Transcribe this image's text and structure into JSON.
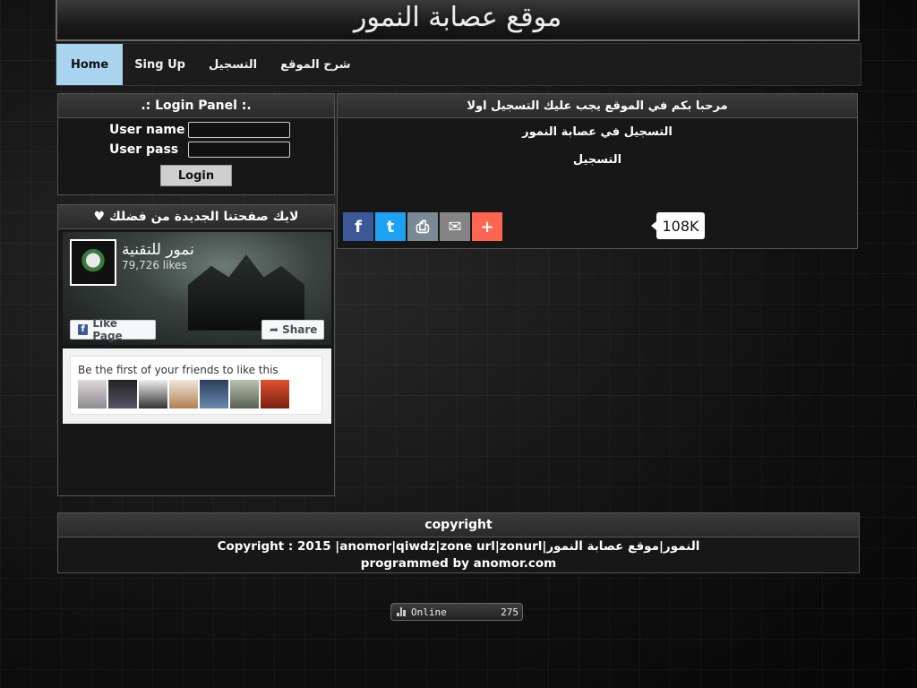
{
  "header": {
    "title": "موقع عصابة النمور"
  },
  "nav": [
    {
      "label": "Home",
      "active": true
    },
    {
      "label": "Sing Up"
    },
    {
      "label": "التسجيل"
    },
    {
      "label": "شرح الموقع"
    }
  ],
  "login": {
    "title": ".: Login Panel :.",
    "username_label": "User name",
    "password_label": "User pass",
    "username_value": "",
    "password_value": "",
    "button": "Login"
  },
  "like_panel": {
    "title": "♥ لايك صفحتنا الجديدة من فضلك",
    "page_name": "نمور للتقنية",
    "likes": "79,726 likes",
    "like_button": "Like Page",
    "share_button": "Share",
    "friends_text": "Be the first of your friends to like this"
  },
  "welcome": {
    "title": "مرحبا بكم في الموقع يجب عليك التسجيل اولا",
    "line1": "التسجيل في عصابة النمور",
    "line2": "التسجيل",
    "share_count": "108K",
    "share_buttons": [
      {
        "icon": "facebook-icon",
        "color": "#3b5998",
        "glyph": "f"
      },
      {
        "icon": "twitter-icon",
        "color": "#1da1f2",
        "glyph": "t"
      },
      {
        "icon": "print-icon",
        "color": "#7a8a94",
        "glyph": "⎙"
      },
      {
        "icon": "email-icon",
        "color": "#848484",
        "glyph": "✉"
      },
      {
        "icon": "plus-icon",
        "color": "#ff6550",
        "glyph": "+"
      }
    ]
  },
  "footer": {
    "title": "copyright",
    "line1": "Copyright : 2015 |anomor|qiwdz|zone url|zonurl|النمور|موقع عصابة النمور",
    "line2": "programmed by anomor.com"
  },
  "online": {
    "label": "Online",
    "count": "275"
  }
}
